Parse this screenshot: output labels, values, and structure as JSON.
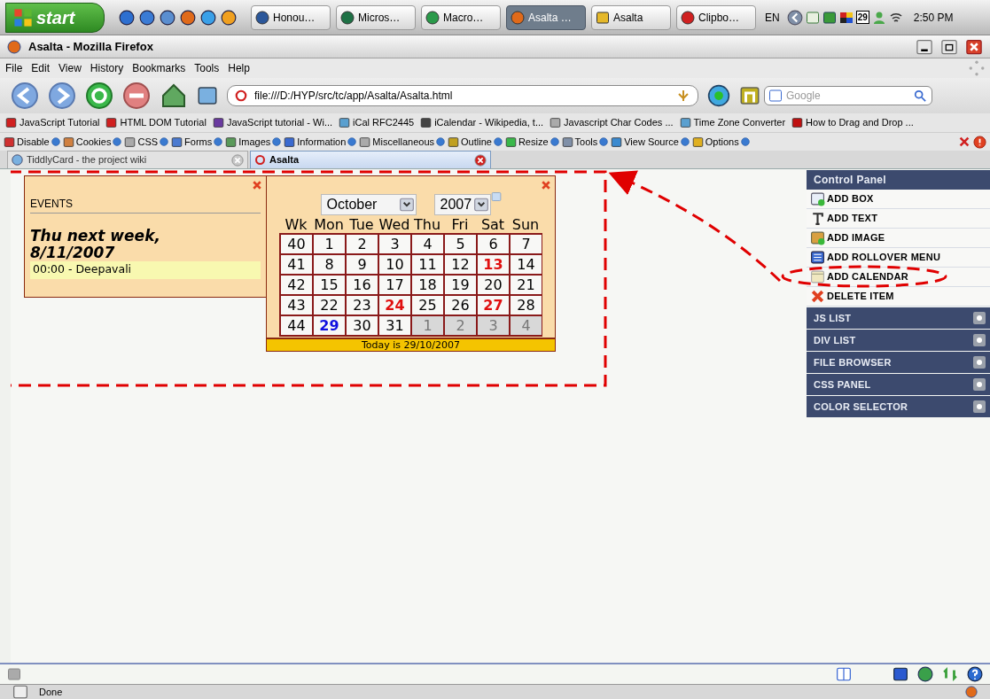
{
  "taskbar": {
    "start": "start",
    "tasks": [
      {
        "label": "Honou…",
        "selected": false
      },
      {
        "label": "Micros…",
        "selected": false
      },
      {
        "label": "Macro…",
        "selected": false
      },
      {
        "label": "Asalta …",
        "selected": true
      },
      {
        "label": "Asalta",
        "selected": false
      },
      {
        "label": "Clipbo…",
        "selected": false
      }
    ],
    "language": "EN",
    "tray_date": "29",
    "clock": "2:50 PM"
  },
  "window": {
    "title": "Asalta - Mozilla Firefox"
  },
  "menu": [
    "File",
    "Edit",
    "View",
    "History",
    "Bookmarks",
    "Tools",
    "Help"
  ],
  "address": {
    "value": "file:///D:/HYP/src/tc/app/Asalta/Asalta.html"
  },
  "search": {
    "placeholder": "Google"
  },
  "bookmarks": [
    "JavaScript Tutorial",
    "HTML DOM Tutorial",
    "JavaScript tutorial - Wi...",
    "iCal RFC2445",
    "iCalendar - Wikipedia, t...",
    "Javascript Char Codes ...",
    "Time Zone Converter",
    "How to Drag and Drop ..."
  ],
  "devtools": [
    "Disable",
    "Cookies",
    "CSS",
    "Forms",
    "Images",
    "Information",
    "Miscellaneous",
    "Outline",
    "Resize",
    "Tools",
    "View Source",
    "Options"
  ],
  "tabs": [
    {
      "label": "TiddlyCard - the project wiki",
      "selected": false
    },
    {
      "label": "Asalta",
      "selected": true
    }
  ],
  "events": {
    "title": "EVENTS",
    "heading": "Thu next week, 8/11/2007",
    "entry": "00:00 - Deepavali"
  },
  "calendar": {
    "month": "October",
    "year": "2007",
    "headers": [
      "Wk",
      "Mon",
      "Tue",
      "Wed",
      "Thu",
      "Fri",
      "Sat",
      "Sun"
    ],
    "weeks": [
      {
        "week": "40",
        "days": [
          {
            "day": "1",
            "kind": "normal"
          },
          {
            "day": "2",
            "kind": "normal"
          },
          {
            "day": "3",
            "kind": "normal"
          },
          {
            "day": "4",
            "kind": "normal"
          },
          {
            "day": "5",
            "kind": "normal"
          },
          {
            "day": "6",
            "kind": "normal"
          },
          {
            "day": "7",
            "kind": "normal"
          }
        ]
      },
      {
        "week": "41",
        "days": [
          {
            "day": "8",
            "kind": "normal"
          },
          {
            "day": "9",
            "kind": "normal"
          },
          {
            "day": "10",
            "kind": "normal"
          },
          {
            "day": "11",
            "kind": "normal"
          },
          {
            "day": "12",
            "kind": "normal"
          },
          {
            "day": "13",
            "kind": "holiday"
          },
          {
            "day": "14",
            "kind": "normal"
          }
        ]
      },
      {
        "week": "42",
        "days": [
          {
            "day": "15",
            "kind": "normal"
          },
          {
            "day": "16",
            "kind": "normal"
          },
          {
            "day": "17",
            "kind": "normal"
          },
          {
            "day": "18",
            "kind": "normal"
          },
          {
            "day": "19",
            "kind": "normal"
          },
          {
            "day": "20",
            "kind": "normal"
          },
          {
            "day": "21",
            "kind": "normal"
          }
        ]
      },
      {
        "week": "43",
        "days": [
          {
            "day": "22",
            "kind": "normal"
          },
          {
            "day": "23",
            "kind": "normal"
          },
          {
            "day": "24",
            "kind": "holiday"
          },
          {
            "day": "25",
            "kind": "normal"
          },
          {
            "day": "26",
            "kind": "normal"
          },
          {
            "day": "27",
            "kind": "holiday"
          },
          {
            "day": "28",
            "kind": "normal"
          }
        ]
      },
      {
        "week": "44",
        "days": [
          {
            "day": "29",
            "kind": "today"
          },
          {
            "day": "30",
            "kind": "normal"
          },
          {
            "day": "31",
            "kind": "normal"
          },
          {
            "day": "1",
            "kind": "other"
          },
          {
            "day": "2",
            "kind": "other"
          },
          {
            "day": "3",
            "kind": "other"
          },
          {
            "day": "4",
            "kind": "other"
          }
        ]
      }
    ],
    "footer": "Today is 29/10/2007"
  },
  "control_panel": {
    "title": "Control Panel",
    "actions": [
      "ADD BOX",
      "ADD TEXT",
      "ADD IMAGE",
      "ADD ROLLOVER MENU",
      "ADD CALENDAR",
      "DELETE ITEM"
    ],
    "sections": [
      "JS LIST",
      "DIV LIST",
      "FILE BROWSER",
      "CSS PANEL",
      "COLOR SELECTOR"
    ]
  },
  "status_bar": {
    "text": "Done"
  }
}
